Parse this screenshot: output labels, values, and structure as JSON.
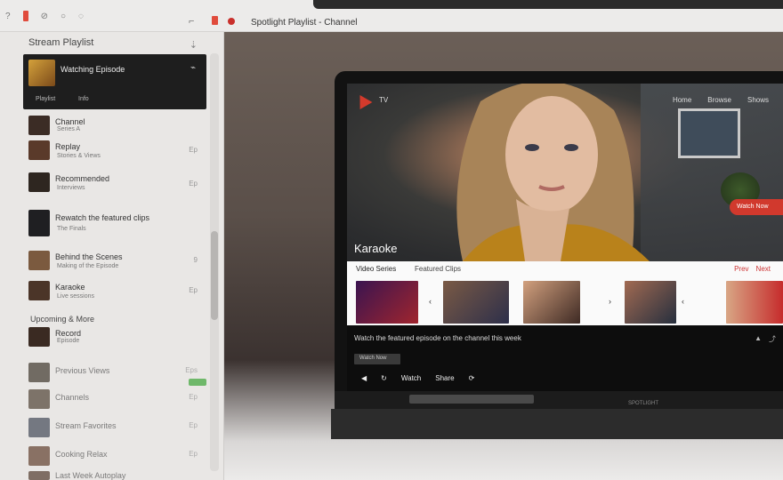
{
  "browser": {
    "tab_title": "Spotlight Playlist - Channel",
    "icons": [
      "back-icon",
      "record-icon",
      "settings-icon",
      "refresh-icon",
      "chat-icon",
      "add-icon",
      "menu-icon"
    ]
  },
  "playlist": {
    "header": "Stream Playlist",
    "now_playing": {
      "title": "Watching Episode",
      "meta_left": "Playlist",
      "meta_right": "Info"
    },
    "items": [
      {
        "title": "Channel",
        "sub": "Series A",
        "meta": ""
      },
      {
        "title": "Replay",
        "sub": "Stories & Views",
        "meta": "Ep"
      },
      {
        "title": "Recommended",
        "sub": "Interviews",
        "meta": "Ep"
      },
      {
        "title": "Rewatch the featured clips",
        "sub": "The Finals",
        "meta": ""
      },
      {
        "title": "Behind the Scenes",
        "sub": "Making of the Episode",
        "meta": "9"
      },
      {
        "title": "Karaoke",
        "sub": "Live sessions",
        "meta": "Ep"
      },
      {
        "title": "Record",
        "sub": "Episode",
        "meta": ""
      },
      {
        "title": "Previous Views",
        "sub": "",
        "meta": "Eps"
      },
      {
        "title": "Channels",
        "sub": "",
        "meta": "Ep"
      },
      {
        "title": "Stream Favorites",
        "sub": "",
        "meta": "Ep"
      },
      {
        "title": "Cooking Relax",
        "sub": "",
        "meta": "Ep"
      },
      {
        "title": "Last Week Autoplay",
        "sub": "",
        "meta": ""
      }
    ],
    "section_label": "Upcoming & More"
  },
  "laptop": {
    "brand": "TV",
    "nav": [
      "Home",
      "Browse",
      "Shows"
    ],
    "cta": "Watch Now",
    "title": "Karaoke",
    "strip_label": "Video Series",
    "strip_label2": "Featured Clips",
    "strip_controls": [
      "Prev",
      "Next"
    ],
    "footer_text": "Watch the featured episode on the channel this week",
    "footer_button": "Watch Now",
    "footer_icons": [
      "up-icon",
      "share-icon"
    ],
    "controls": {
      "label1": "Watch",
      "label2": "Share"
    },
    "hinge_label": "SPOTLIGHT",
    "accent": "#d1392d"
  }
}
